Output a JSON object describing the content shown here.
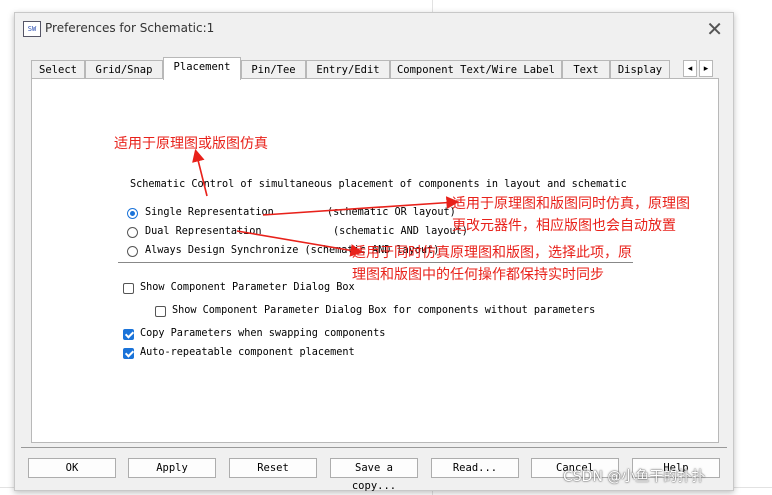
{
  "window": {
    "title": "Preferences for Schematic:1",
    "app_icon_text": "SW",
    "close_glyph": "✕"
  },
  "tabs": [
    {
      "label": "Select"
    },
    {
      "label": "Grid/Snap"
    },
    {
      "label": "Placement"
    },
    {
      "label": "Pin/Tee"
    },
    {
      "label": "Entry/Edit"
    },
    {
      "label": "Component Text/Wire Label"
    },
    {
      "label": "Text"
    },
    {
      "label": "Display"
    }
  ],
  "tab_scroll": {
    "left": "◂",
    "right": "▸"
  },
  "active_tab": "Placement",
  "panel": {
    "section_label": "Schematic Control of simultaneous placement of components in layout and schematic",
    "radios": [
      {
        "label": "Single Representation",
        "note": "(schematic OR layout)",
        "selected": true
      },
      {
        "label": "Dual Representation",
        "note": "(schematic AND layout)",
        "selected": false
      },
      {
        "label": "Always Design Synchronize (schematic AND layout)",
        "note": "",
        "selected": false
      }
    ],
    "checkboxes": [
      {
        "label": "Show Component Parameter Dialog Box",
        "checked": false
      },
      {
        "label": "Show Component Parameter Dialog Box for components without parameters",
        "checked": false
      },
      {
        "label": "Copy Parameters when swapping components",
        "checked": true
      },
      {
        "label": "Auto-repeatable component placement",
        "checked": true
      }
    ]
  },
  "buttons": {
    "ok": "OK",
    "apply": "Apply",
    "reset": "Reset",
    "save_copy": "Save a copy...",
    "read": "Read...",
    "cancel": "Cancel",
    "help": "Help"
  },
  "annotations": {
    "a1": "适用于原理图或版图仿真",
    "a2": "适用于原理图和版图同时仿真，原理图\n更改元器件，相应版图也会自动放置",
    "a3": "适用于同时仿真原理图和版图，选择此项，原\n理图和版图中的任何操作都保持实时同步",
    "color": "#e8211a"
  },
  "watermark": "CSDN @小鱼干的扑扑"
}
